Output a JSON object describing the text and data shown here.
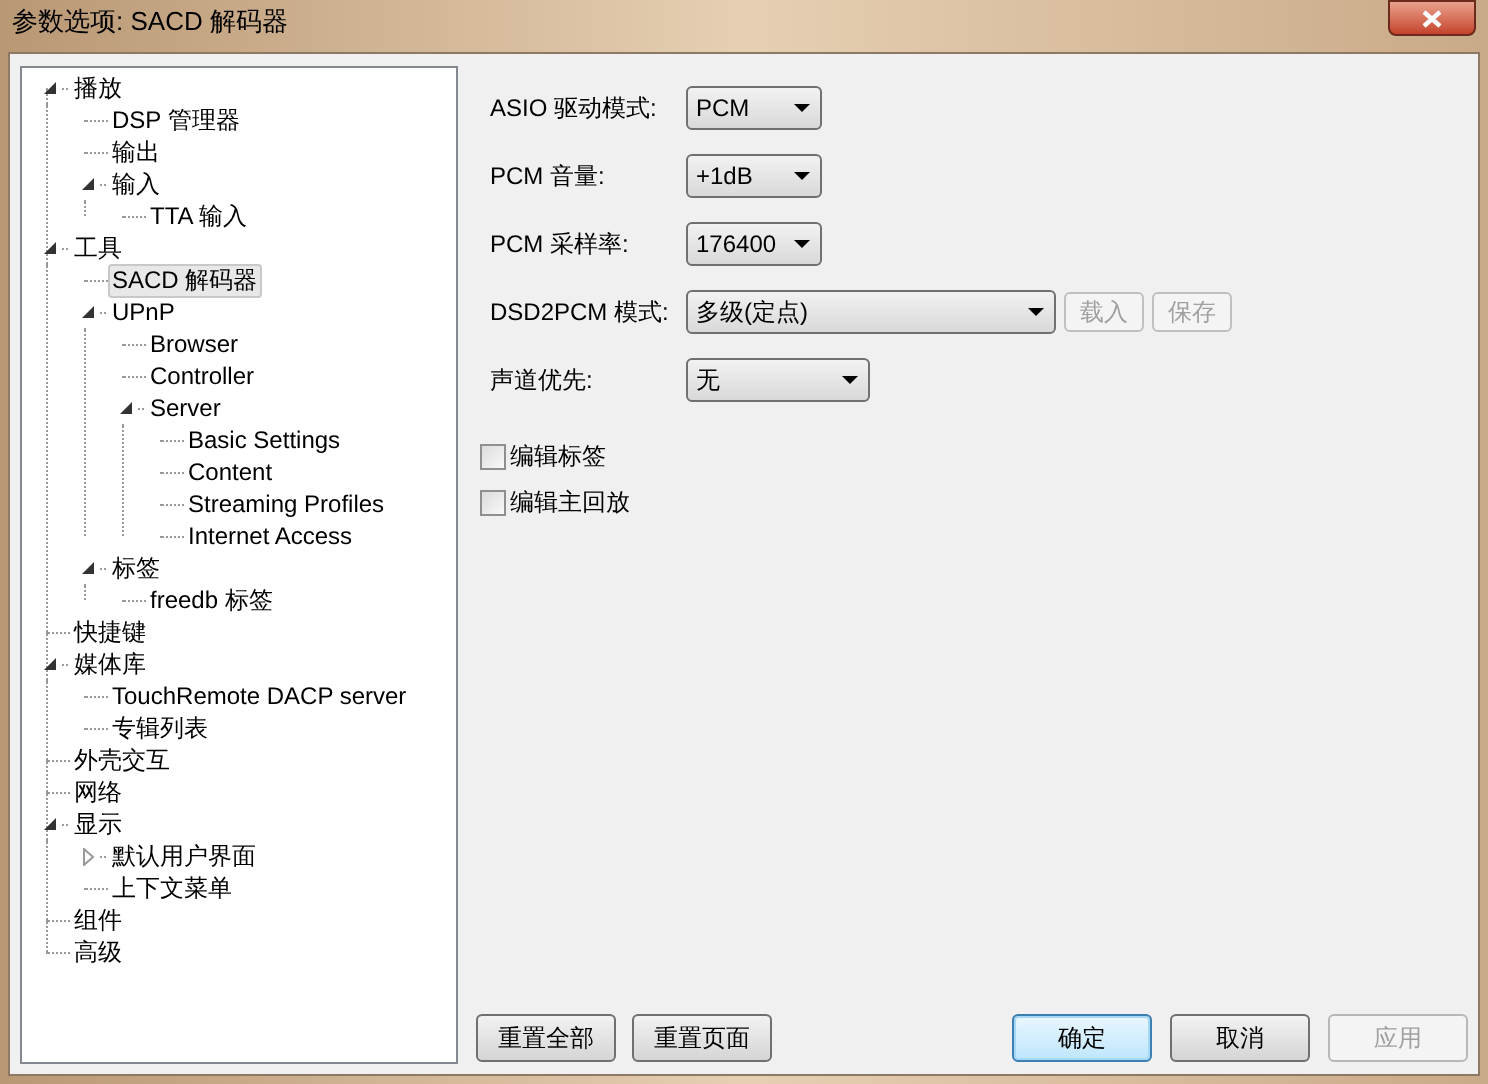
{
  "window": {
    "title": "参数选项: SACD 解码器"
  },
  "tree": [
    {
      "label": "播放",
      "expanded": true,
      "selected": false,
      "children": [
        {
          "label": "DSP 管理器",
          "selected": false
        },
        {
          "label": "输出",
          "selected": false
        },
        {
          "label": "输入",
          "expanded": true,
          "selected": false,
          "children": [
            {
              "label": "TTA 输入",
              "selected": false
            }
          ]
        }
      ]
    },
    {
      "label": "工具",
      "expanded": true,
      "selected": false,
      "children": [
        {
          "label": "SACD 解码器",
          "selected": true
        },
        {
          "label": "UPnP",
          "expanded": true,
          "selected": false,
          "children": [
            {
              "label": "Browser",
              "selected": false
            },
            {
              "label": "Controller",
              "selected": false
            },
            {
              "label": "Server",
              "expanded": true,
              "selected": false,
              "children": [
                {
                  "label": "Basic Settings",
                  "selected": false
                },
                {
                  "label": "Content",
                  "selected": false
                },
                {
                  "label": "Streaming Profiles",
                  "selected": false
                },
                {
                  "label": "Internet Access",
                  "selected": false
                }
              ]
            }
          ]
        },
        {
          "label": "标签",
          "expanded": true,
          "selected": false,
          "children": [
            {
              "label": "freedb 标签",
              "selected": false
            }
          ]
        }
      ]
    },
    {
      "label": "快捷键",
      "selected": false
    },
    {
      "label": "媒体库",
      "expanded": true,
      "selected": false,
      "children": [
        {
          "label": "TouchRemote DACP server",
          "selected": false
        },
        {
          "label": "专辑列表",
          "selected": false
        }
      ]
    },
    {
      "label": "外壳交互",
      "selected": false
    },
    {
      "label": "网络",
      "selected": false
    },
    {
      "label": "显示",
      "expanded": true,
      "selected": false,
      "children": [
        {
          "label": "默认用户界面",
          "expanded": false,
          "selected": false
        },
        {
          "label": "上下文菜单",
          "selected": false
        }
      ]
    },
    {
      "label": "组件",
      "selected": false
    },
    {
      "label": "高级",
      "selected": false
    }
  ],
  "settings": [
    {
      "label": "ASIO 驱动模式:",
      "value": "PCM"
    },
    {
      "label": "PCM 音量:",
      "value": "+1dB"
    },
    {
      "label": "PCM 采样率:",
      "value": "176400"
    },
    {
      "label": "DSD2PCM 模式:",
      "value": "多级(定点)",
      "buttons": [
        {
          "label": "载入",
          "disabled": true
        },
        {
          "label": "保存",
          "disabled": true
        }
      ]
    },
    {
      "label": "声道优先:",
      "value": "无"
    }
  ],
  "checkboxes": [
    {
      "label": "编辑标签",
      "checked": false
    },
    {
      "label": "编辑主回放",
      "checked": false
    }
  ],
  "left_buttons": [
    {
      "label": "重置全部",
      "disabled": false
    },
    {
      "label": "重置页面",
      "disabled": false
    }
  ],
  "right_buttons": [
    {
      "label": "确定",
      "default": true,
      "disabled": false
    },
    {
      "label": "取消",
      "default": false,
      "disabled": false
    },
    {
      "label": "应用",
      "default": false,
      "disabled": true
    }
  ]
}
